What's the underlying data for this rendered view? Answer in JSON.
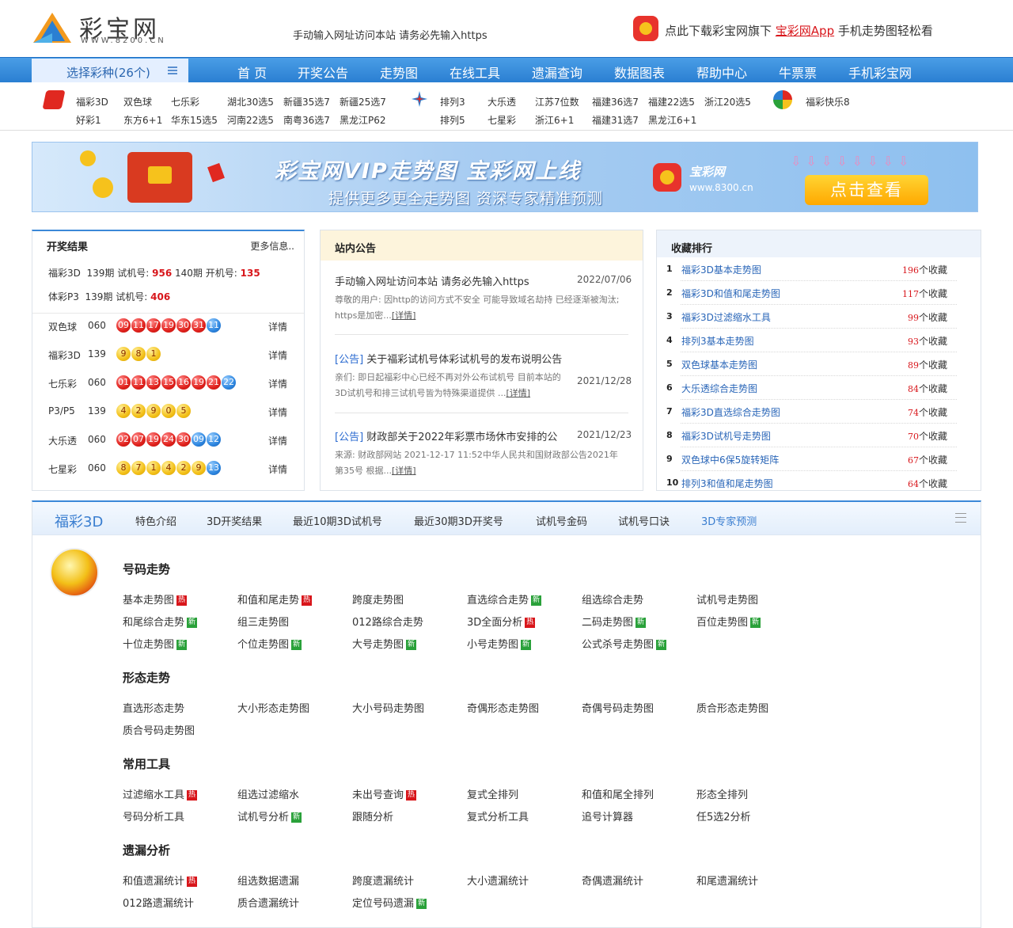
{
  "header": {
    "logo_text": "彩宝网",
    "logo_url": "WWW.8200.CN",
    "notice": "手动输入网址访问本站 请务必先输入https",
    "app_promo_pre": "点此下载彩宝网旗下",
    "app_promo_link": "宝彩网App",
    "app_promo_post": "手机走势图轻松看"
  },
  "nav": {
    "select_label": "选择彩种(26个)",
    "items": [
      "首 页",
      "开奖公告",
      "走势图",
      "在线工具",
      "遗漏查询",
      "数据图表",
      "帮助中心",
      "牛票票",
      "手机彩宝网"
    ]
  },
  "lottery_links": {
    "fc_row1": [
      "福彩3D",
      "双色球",
      "七乐彩",
      "湖北30选5",
      "新疆35选7",
      "新疆25选7"
    ],
    "fc_row2": [
      "好彩1",
      "东方6+1",
      "华东15选5",
      "河南22选5",
      "南粤36选7",
      "黑龙江P62"
    ],
    "tc_row1": [
      "排列3",
      "大乐透",
      "江苏7位数",
      "福建36选7",
      "福建22选5",
      "浙江20选5"
    ],
    "tc_row2": [
      "排列5",
      "七星彩",
      "浙江6+1",
      "福建31选7",
      "黑龙江6+1"
    ],
    "other_row1": [
      "福彩快乐8"
    ]
  },
  "banner": {
    "title": "彩宝网VIP走势图  宝彩网上线",
    "subtitle": "提供更多更全走势图  资深专家精准预测",
    "brand": "宝彩网",
    "url": "www.8300.cn",
    "button": "点击查看",
    "arrows": "⇩⇩⇩⇩⇩⇩⇩⇩"
  },
  "results": {
    "title": "开奖结果",
    "more": "更多信息..",
    "test_rows": [
      {
        "name": "福彩3D",
        "issue1": "139期",
        "label1": "试机号:",
        "val1": "956",
        "issue2": "140期",
        "label2": "开机号:",
        "val2": "135"
      },
      {
        "name": "体彩P3",
        "issue1": "139期",
        "label1": "试机号:",
        "val1": "406"
      }
    ],
    "draws": [
      {
        "name": "双色球",
        "issue": "060",
        "balls": [
          {
            "n": "09",
            "c": "red"
          },
          {
            "n": "11",
            "c": "red"
          },
          {
            "n": "17",
            "c": "red"
          },
          {
            "n": "19",
            "c": "red"
          },
          {
            "n": "30",
            "c": "red"
          },
          {
            "n": "31",
            "c": "red"
          },
          {
            "n": "11",
            "c": "blue"
          }
        ],
        "detail": "详情"
      },
      {
        "name": "福彩3D",
        "issue": "139",
        "balls": [
          {
            "n": "9",
            "c": "yel"
          },
          {
            "n": "8",
            "c": "yel"
          },
          {
            "n": "1",
            "c": "yel"
          }
        ],
        "detail": "详情"
      },
      {
        "name": "七乐彩",
        "issue": "060",
        "balls": [
          {
            "n": "01",
            "c": "red"
          },
          {
            "n": "11",
            "c": "red"
          },
          {
            "n": "13",
            "c": "red"
          },
          {
            "n": "15",
            "c": "red"
          },
          {
            "n": "16",
            "c": "red"
          },
          {
            "n": "19",
            "c": "red"
          },
          {
            "n": "21",
            "c": "red"
          },
          {
            "n": "22",
            "c": "blue"
          }
        ],
        "detail": "详情"
      },
      {
        "name": "P3/P5",
        "issue": "139",
        "balls": [
          {
            "n": "4",
            "c": "yel"
          },
          {
            "n": "2",
            "c": "yel"
          },
          {
            "n": "9",
            "c": "yel"
          },
          {
            "n": "0",
            "c": "yel"
          },
          {
            "n": "5",
            "c": "yel"
          }
        ],
        "detail": "详情"
      },
      {
        "name": "大乐透",
        "issue": "060",
        "balls": [
          {
            "n": "02",
            "c": "red"
          },
          {
            "n": "07",
            "c": "red"
          },
          {
            "n": "19",
            "c": "red"
          },
          {
            "n": "24",
            "c": "red"
          },
          {
            "n": "30",
            "c": "red"
          },
          {
            "n": "09",
            "c": "blue"
          },
          {
            "n": "12",
            "c": "blue"
          }
        ],
        "detail": "详情"
      },
      {
        "name": "七星彩",
        "issue": "060",
        "balls": [
          {
            "n": "8",
            "c": "yel"
          },
          {
            "n": "7",
            "c": "yel"
          },
          {
            "n": "1",
            "c": "yel"
          },
          {
            "n": "4",
            "c": "yel"
          },
          {
            "n": "2",
            "c": "yel"
          },
          {
            "n": "9",
            "c": "yel"
          },
          {
            "n": "13",
            "c": "blue"
          }
        ],
        "detail": "详情"
      }
    ]
  },
  "announcements": {
    "title": "站内公告",
    "items": [
      {
        "tag": "",
        "title": "手动输入网址访问本站 请务必先输入https",
        "date": "2022/07/06",
        "body": "尊敬的用户: 因http的访问方式不安全 可能导致域名劫持 已经逐渐被淘汰; https是加密...",
        "detail": "[详情]"
      },
      {
        "tag": "[公告]",
        "title": " 关于福彩试机号体彩试机号的发布说明公告",
        "date": "2021/12/28",
        "body": "亲们:  即日起福彩中心已经不再对外公布试机号 目前本站的3D试机号和排三试机号皆为特殊渠道提供 ...",
        "detail": "[详情]"
      },
      {
        "tag": "[公告]",
        "title": " 财政部关于2022年彩票市场休市安排的公",
        "date": "2021/12/23",
        "body": "来源:  财政部网站 2021-12-17 11:52中华人民共和国财政部公告2021年第35号 根据...",
        "detail": "[详情]"
      }
    ]
  },
  "ranking": {
    "title": "收藏排行",
    "suffix": "个收藏",
    "items": [
      {
        "no": "1",
        "name": "福彩3D基本走势图",
        "count": "196"
      },
      {
        "no": "2",
        "name": "福彩3D和值和尾走势图",
        "count": "117"
      },
      {
        "no": "3",
        "name": "福彩3D过滤缩水工具",
        "count": "99"
      },
      {
        "no": "4",
        "name": "排列3基本走势图",
        "count": "93"
      },
      {
        "no": "5",
        "name": "双色球基本走势图",
        "count": "89"
      },
      {
        "no": "6",
        "name": "大乐透综合走势图",
        "count": "84"
      },
      {
        "no": "7",
        "name": "福彩3D直选综合走势图",
        "count": "74"
      },
      {
        "no": "8",
        "name": "福彩3D试机号走势图",
        "count": "70"
      },
      {
        "no": "9",
        "name": "双色球中6保5旋转矩阵",
        "count": "67"
      },
      {
        "no": "10",
        "name": "排列3和值和尾走势图",
        "count": "64"
      }
    ]
  },
  "fc3d": {
    "title": "福彩3D",
    "tabs": [
      "特色介绍",
      "3D开奖结果",
      "最近10期3D试机号",
      "最近30期3D开奖号",
      "试机号金码",
      "试机号口诀",
      "3D专家预测"
    ],
    "hot_label": "热",
    "new_label": "新",
    "sections": [
      {
        "title": "号码走势",
        "tools": [
          {
            "name": "基本走势图",
            "badge": "hot"
          },
          {
            "name": "和值和尾走势",
            "badge": "hot"
          },
          {
            "name": "跨度走势图",
            "badge": ""
          },
          {
            "name": "直选综合走势",
            "badge": "new"
          },
          {
            "name": "组选综合走势",
            "badge": ""
          },
          {
            "name": "试机号走势图",
            "badge": ""
          },
          {
            "name": "和尾综合走势",
            "badge": "new"
          },
          {
            "name": "组三走势图",
            "badge": ""
          },
          {
            "name": "012路综合走势",
            "badge": ""
          },
          {
            "name": "3D全面分析",
            "badge": "hot"
          },
          {
            "name": "二码走势图",
            "badge": "new"
          },
          {
            "name": "百位走势图",
            "badge": "new"
          },
          {
            "name": "十位走势图",
            "badge": "new"
          },
          {
            "name": "个位走势图",
            "badge": "new"
          },
          {
            "name": "大号走势图",
            "badge": "new"
          },
          {
            "name": "小号走势图",
            "badge": "new"
          },
          {
            "name": "公式杀号走势图",
            "badge": "new"
          }
        ]
      },
      {
        "title": "形态走势",
        "tools": [
          {
            "name": "直选形态走势",
            "badge": ""
          },
          {
            "name": "大小形态走势图",
            "badge": ""
          },
          {
            "name": "大小号码走势图",
            "badge": ""
          },
          {
            "name": "奇偶形态走势图",
            "badge": ""
          },
          {
            "name": "奇偶号码走势图",
            "badge": ""
          },
          {
            "name": "质合形态走势图",
            "badge": ""
          },
          {
            "name": "质合号码走势图",
            "badge": ""
          }
        ]
      },
      {
        "title": "常用工具",
        "tools": [
          {
            "name": "过滤缩水工具",
            "badge": "hot"
          },
          {
            "name": "组选过滤缩水",
            "badge": ""
          },
          {
            "name": "未出号查询",
            "badge": "hot"
          },
          {
            "name": "复式全排列",
            "badge": ""
          },
          {
            "name": "和值和尾全排列",
            "badge": ""
          },
          {
            "name": "形态全排列",
            "badge": ""
          },
          {
            "name": "号码分析工具",
            "badge": ""
          },
          {
            "name": "试机号分析",
            "badge": "new"
          },
          {
            "name": "跟随分析",
            "badge": ""
          },
          {
            "name": "复式分析工具",
            "badge": ""
          },
          {
            "name": "追号计算器",
            "badge": ""
          },
          {
            "name": "任5选2分析",
            "badge": ""
          }
        ]
      },
      {
        "title": "遗漏分析",
        "tools": [
          {
            "name": "和值遗漏统计",
            "badge": "hot"
          },
          {
            "name": "组选数据遗漏",
            "badge": ""
          },
          {
            "name": "跨度遗漏统计",
            "badge": ""
          },
          {
            "name": "大小遗漏统计",
            "badge": ""
          },
          {
            "name": "奇偶遗漏统计",
            "badge": ""
          },
          {
            "name": "和尾遗漏统计",
            "badge": ""
          },
          {
            "name": "012路遗漏统计",
            "badge": ""
          },
          {
            "name": "质合遗漏统计",
            "badge": ""
          },
          {
            "name": "定位号码遗漏",
            "badge": "new"
          }
        ]
      }
    ]
  }
}
